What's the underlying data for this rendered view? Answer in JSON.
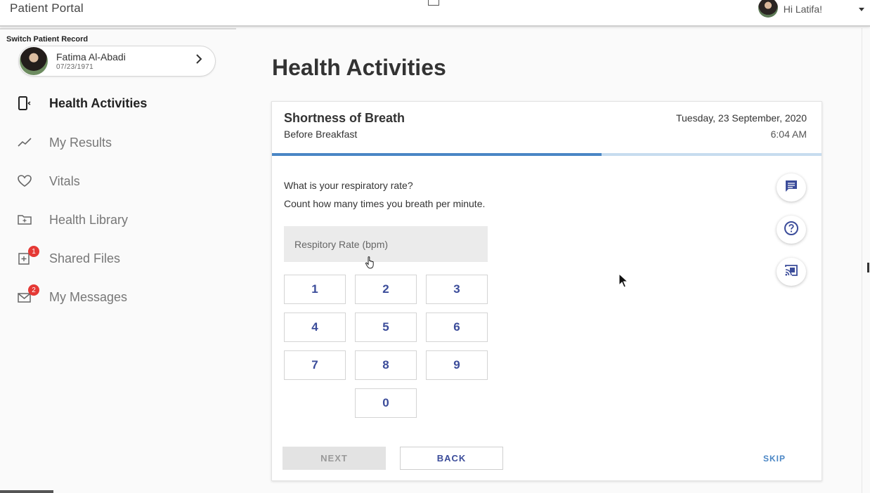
{
  "app": {
    "title": "Patient Portal",
    "greeting": "Hi Latifa!"
  },
  "patient": {
    "switch_label": "Switch Patient Record",
    "name": "Fatima Al-Abadi",
    "dob": "07/23/1971"
  },
  "nav": [
    {
      "label": "Health Activities",
      "icon": "device-icon",
      "active": true
    },
    {
      "label": "My Results",
      "icon": "trend-icon"
    },
    {
      "label": "Vitals",
      "icon": "heart-icon"
    },
    {
      "label": "Health Library",
      "icon": "folder-icon"
    },
    {
      "label": "Shared Files",
      "icon": "file-add-icon",
      "badge": "1"
    },
    {
      "label": "My Messages",
      "icon": "mail-icon",
      "badge": "2"
    }
  ],
  "main": {
    "title": "Health Activities",
    "activity": {
      "name": "Shortness of Breath",
      "subtitle": "Before Breakfast",
      "date": "Tuesday, 23 September, 2020",
      "time": "6:04 AM",
      "progress": 0.6
    },
    "question": "What is your respiratory rate?",
    "instruction": "Count how many times you breath per minute.",
    "input": {
      "placeholder": "Respitory Rate (bpm)",
      "value": ""
    },
    "keypad": [
      "1",
      "2",
      "3",
      "4",
      "5",
      "6",
      "7",
      "8",
      "9",
      "0"
    ],
    "side_buttons": [
      "comment-icon",
      "help-icon",
      "cast-icon"
    ],
    "buttons": {
      "next": "NEXT",
      "back": "BACK",
      "skip": "SKIP"
    }
  },
  "colors": {
    "accent": "#3b4c9a",
    "progress": "#4a86c5",
    "badge": "#e53935"
  }
}
